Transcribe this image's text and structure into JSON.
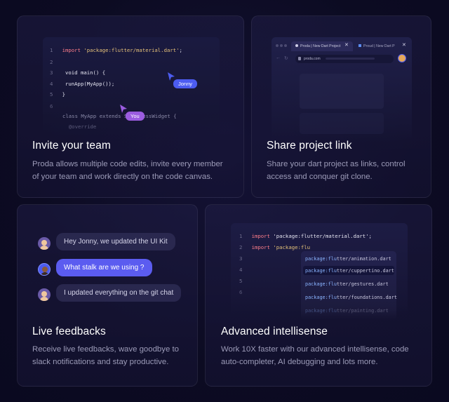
{
  "cards": {
    "team": {
      "title": "Invite your team",
      "desc_line1": "Proda allows multiple code edits, invite every member",
      "desc_line2": "of your team and work directly on the code canvas.",
      "code": {
        "l1": {
          "num": "1",
          "kw": "import ",
          "str": "'package:flutter/material.dart'",
          "end": ";"
        },
        "l2": {
          "num": "2"
        },
        "l3": {
          "num": "3",
          "text": " void main() {"
        },
        "l4": {
          "num": "4",
          "text": " runApp(MyApp());"
        },
        "l5": {
          "num": "5",
          "text": "}"
        },
        "l6": {
          "num": "6"
        },
        "l7": {
          "text": "class MyApp extends StatelessWidget {"
        },
        "l8": {
          "text": "  @override"
        }
      },
      "cursors": {
        "jonny": "Jonny",
        "you": "You"
      }
    },
    "share": {
      "title": "Share project link",
      "desc_line1": "Share your dart project as links, control",
      "desc_line2": "access and conquer git clone.",
      "browser": {
        "tab1": "Proda | New Dart Project",
        "tab2": "Proud | New Dart P",
        "url": "proda.com"
      }
    },
    "feedback": {
      "title": "Live feedbacks",
      "desc_line1": "Receive live feedbacks, wave goodbye to",
      "desc_line2": "slack notifications and stay productive.",
      "messages": [
        "Hey Jonny, we updated the UI Kit",
        "What stalk are we using ?",
        "I updated everything on the git chat"
      ]
    },
    "intellisense": {
      "title": "Advanced intellisense",
      "desc_line1": "Work 10X faster with our advanced intellisense, code",
      "desc_line2": "auto-completer, AI debugging and lots more.",
      "code": {
        "l1": {
          "num": "1",
          "kw": "import ",
          "str": "'package:flutter/material.dart'",
          "end": ";"
        },
        "l2": {
          "num": "2",
          "kw": "import ",
          "str": "'package:flu"
        },
        "l3": {
          "num": "3"
        },
        "l4": {
          "num": "4"
        },
        "l5": {
          "num": "5"
        },
        "l6": {
          "num": "6"
        }
      },
      "suggestions": [
        {
          "pk": "package:flu",
          "rest": "tter/animation.dart"
        },
        {
          "pk": "package:flu",
          "rest": "tter/cuppertino.dart"
        },
        {
          "pk": "package:flu",
          "rest": "tter/gestures.dart"
        },
        {
          "pk": "package:flu",
          "rest": "tter/foundations.dart"
        },
        {
          "pk": "package:flu",
          "rest": "tter/painting.dart"
        }
      ]
    }
  },
  "colors": {
    "accent": "#5b5cf0",
    "jonny_tag": "#4c5cf0",
    "you_tag": "#9b5ce0"
  }
}
